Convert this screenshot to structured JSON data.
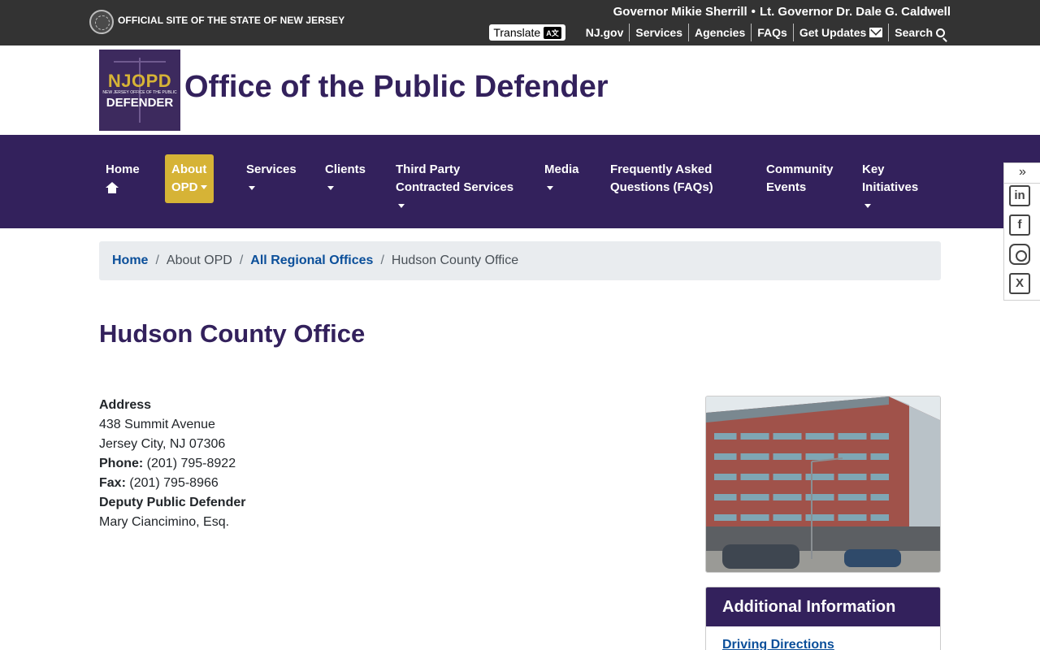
{
  "statebar": {
    "official_text": "OFFICIAL SITE OF THE STATE OF NEW JERSEY",
    "governor": "Governor Mikie Sherrill",
    "separator": "•",
    "lt_governor": "Lt. Governor Dr. Dale G. Caldwell",
    "translate_label": "Translate",
    "translate_icon_text": "A文",
    "links": [
      "NJ.gov",
      "Services",
      "Agencies",
      "FAQs",
      "Get Updates",
      "Search"
    ]
  },
  "header": {
    "logo": {
      "short": "NJOPD",
      "subline": "NEW JERSEY OFFICE OF THE PUBLIC",
      "word": "DEFENDER"
    },
    "site_title": "Office of the Public Defender"
  },
  "nav": {
    "home": "Home",
    "about_1": "About",
    "about_2": "OPD",
    "services": "Services",
    "clients": "Clients",
    "third_1": "Third Party",
    "third_2": "Contracted Services",
    "media": "Media",
    "faq_1": "Frequently Asked",
    "faq_2": "Questions (FAQs)",
    "community_1": "Community",
    "community_2": "Events",
    "key_1": "Key",
    "key_2": "Initiatives",
    "active_color": "#d6b336",
    "bar_color": "#33215c"
  },
  "social": {
    "collapse": "»",
    "linkedin": "in",
    "facebook": "f",
    "instagram": "",
    "x": "X"
  },
  "breadcrumb": {
    "home": "Home",
    "about": "About OPD",
    "regional": "All Regional Offices",
    "current": "Hudson County Office",
    "sep": "/"
  },
  "page_title": "Hudson County Office",
  "office": {
    "address_label": "Address",
    "street": "438 Summit Avenue",
    "city": "Jersey City, NJ 07306",
    "phone_label": "Phone:",
    "phone": "(201) 795-8922",
    "fax_label": "Fax:",
    "fax": "(201) 795-8966",
    "deputy_label": "Deputy Public Defender",
    "deputy": "Mary Ciancimino, Esq."
  },
  "sidebar": {
    "card_title": "Additional Information",
    "link": "Driving Directions"
  }
}
